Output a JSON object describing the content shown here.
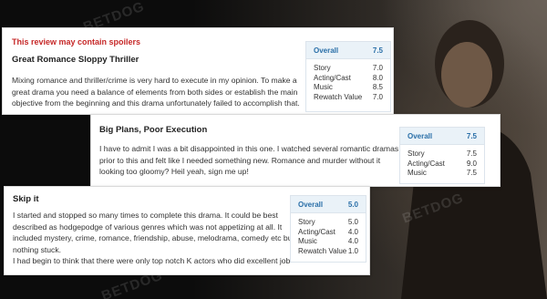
{
  "watermark": "BETDOG",
  "reviews": [
    {
      "spoiler": "This review may contain spoilers",
      "title": "Great Romance Sloppy Thriller",
      "lines": [
        "Mixing romance and thriller/crime is very hard to execute in my opinion. To make a",
        "great drama you need a balance of elements from both sides or establish the main",
        "objective from the beginning and this drama unfortunately failed to accomplish that."
      ],
      "overall_label": "Overall",
      "overall_value": "7.5",
      "ratings": [
        {
          "label": "Story",
          "value": "7.0"
        },
        {
          "label": "Acting/Cast",
          "value": "8.0"
        },
        {
          "label": "Music",
          "value": "8.5"
        },
        {
          "label": "Rewatch Value",
          "value": "7.0"
        }
      ]
    },
    {
      "title": "Big Plans, Poor Execution",
      "lines": [
        "I have to admit I was a bit disappointed in this one. I watched several romantic dramas",
        "prior to this and felt like I needed something new. Romance and murder without it",
        "looking too gloomy? Heil yeah, sign me up!"
      ],
      "overall_label": "Overall",
      "overall_value": "7.5",
      "ratings": [
        {
          "label": "Story",
          "value": "7.5"
        },
        {
          "label": "Acting/Cast",
          "value": "9.0"
        },
        {
          "label": "Music",
          "value": "7.5"
        }
      ]
    },
    {
      "title": "Skip it",
      "lines": [
        "I started and stopped so many times to complete this drama. It could be best",
        "described as hodgepodge of various genres which was not appetizing at all. It",
        "included mystery, crime, romance, friendship, abuse, melodrama, comedy etc but",
        "nothing stuck.",
        "I had begin to think that there were only top notch K actors who did excellent job"
      ],
      "overall_label": "Overall",
      "overall_value": "5.0",
      "ratings": [
        {
          "label": "Story",
          "value": "5.0"
        },
        {
          "label": "Acting/Cast",
          "value": "4.0"
        },
        {
          "label": "Music",
          "value": "4.0"
        },
        {
          "label": "Rewatch Value",
          "value": "1.0"
        }
      ]
    }
  ]
}
